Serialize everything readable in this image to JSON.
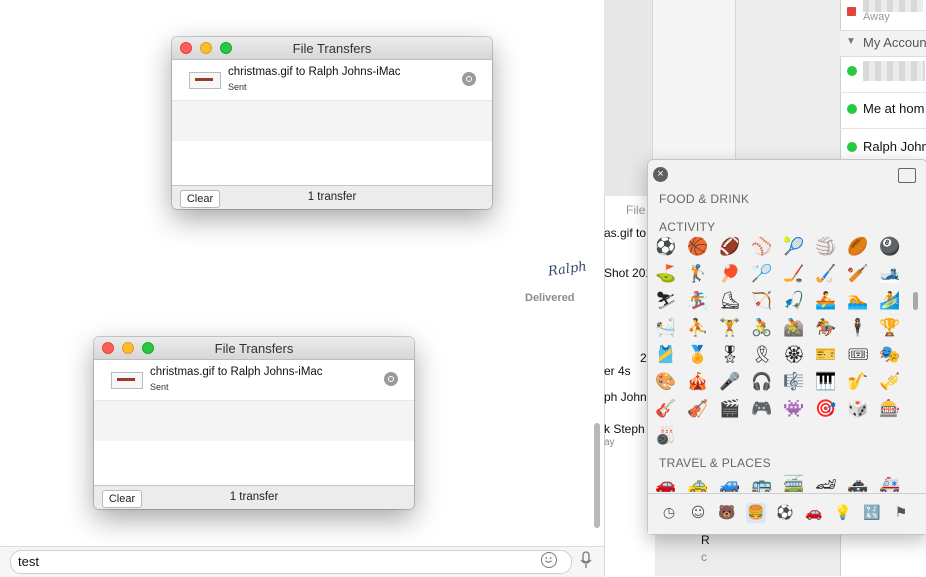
{
  "messages": {
    "signature": "Ralph",
    "delivered": "Delivered",
    "input_value": "test"
  },
  "background_window": {
    "fragments": [
      "File",
      "as.gif to",
      "Shot 201",
      "2",
      "er 4s",
      "ph John",
      "k Steph",
      "ay",
      "R",
      "c"
    ]
  },
  "buddy_list": {
    "away_label": "Away",
    "group_label": "My Accoun",
    "items": [
      {
        "name": "Me at hom",
        "status": "available"
      },
      {
        "name": "Ralph John",
        "status": "available"
      }
    ],
    "status_colors": {
      "available": "#27c93f",
      "away": "#e0443a"
    }
  },
  "file_transfers": [
    {
      "title": "File Transfers",
      "item_name": "christmas.gif to Ralph Johns-iMac",
      "item_status": "Sent",
      "clear_label": "Clear",
      "count_label": "1 transfer"
    },
    {
      "title": "File Transfers",
      "item_name": "christmas.gif to Ralph Johns-iMac",
      "item_status": "Sent",
      "clear_label": "Clear",
      "count_label": "1 transfer"
    }
  ],
  "emoji_picker": {
    "close_icon": "×",
    "section_food": "FOOD & DRINK",
    "section_activity": "ACTIVITY",
    "section_travel": "TRAVEL & PLACES",
    "activity_emojis": [
      "⚽",
      "🏀",
      "🏈",
      "⚾",
      "🎾",
      "🏐",
      "🏉",
      "🎱",
      "⛳",
      "🏌",
      "🏓",
      "🏸",
      "🏒",
      "🏑",
      "🏏",
      "🎿",
      "⛷",
      "🏂",
      "⛸",
      "🏹",
      "🎣",
      "🚣",
      "🏊",
      "🏄",
      "🛀",
      "⛹",
      "🏋",
      "🚴",
      "🚵",
      "🏇",
      "🕴",
      "🏆",
      "🎽",
      "🏅",
      "🎖",
      "🎗",
      "🏵",
      "🎫",
      "🎟",
      "🎭",
      "🎨",
      "🎪",
      "🎤",
      "🎧",
      "🎼",
      "🎹",
      "🎷",
      "🎺",
      "🎸",
      "🎻",
      "🎬",
      "🎮",
      "👾",
      "🎯",
      "🎲",
      "🎰",
      "🎳"
    ],
    "travel_emojis": [
      "🚗",
      "🚕",
      "🚙",
      "🚌",
      "🚎",
      "🏎",
      "🚓",
      "🚑"
    ],
    "tab_icons": [
      "clock-icon",
      "smiley-icon",
      "animal-icon",
      "food-icon",
      "ball-icon",
      "car-icon",
      "bulb-icon",
      "symbols-icon",
      "flag-icon"
    ],
    "tab_glyphs": [
      "◷",
      "☺",
      "🐻",
      "🍔",
      "⚽",
      "🚗",
      "💡",
      "🔣",
      "⚑"
    ],
    "selected_tab": 3
  },
  "colors": {
    "traffic_red": "#fc5f57",
    "traffic_yellow": "#fdbc2e",
    "traffic_green": "#28c840",
    "accent_blue": "#2a6de0"
  }
}
